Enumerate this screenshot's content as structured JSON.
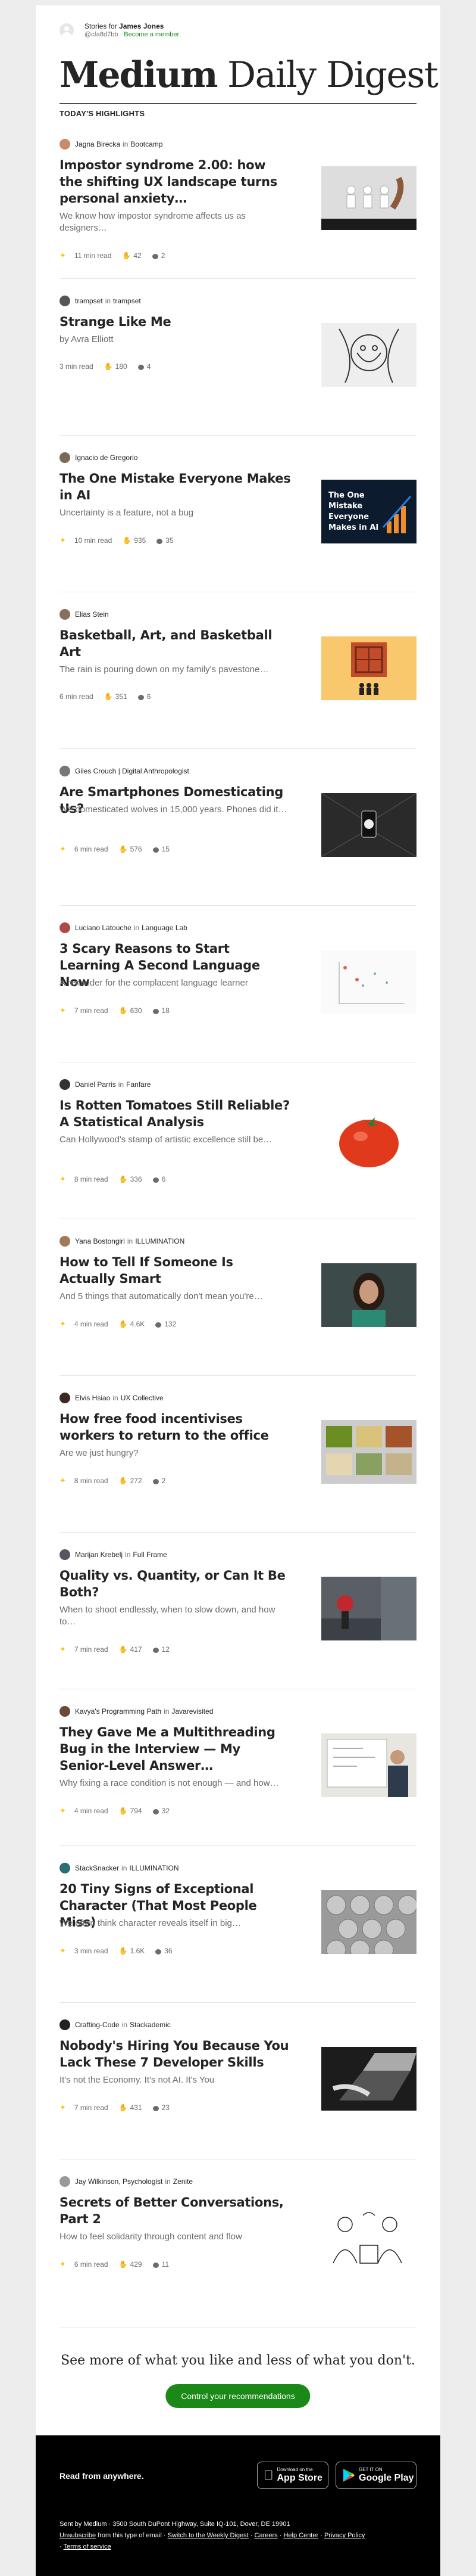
{
  "header": {
    "stories_for_prefix": "Stories for",
    "user_name": "James Jones",
    "handle": "@cfa8d7bb",
    "separator": "·",
    "become_member": "Become a member",
    "masthead_bold": "Medium",
    "masthead_rest": "Daily Digest",
    "section_title": "TODAY'S HIGHLIGHTS"
  },
  "articles": [
    {
      "author": "Jagna Birecka",
      "in": "in",
      "publication": "Bootcamp",
      "title": "Impostor syndrome 2.00: how the shifting UX landscape turns personal anxiety…",
      "subtitle": "We know how impostor syndrome affects us as designers…",
      "read": "11 min read",
      "claps": "42",
      "responses": "2",
      "member": true
    },
    {
      "author": "trampset",
      "in": "in",
      "publication": "trampset",
      "title": "Strange Like Me",
      "subtitle": "by Avra Elliott",
      "read": "3 min read",
      "claps": "180",
      "responses": "4",
      "member": false
    },
    {
      "author": "Ignacio de Gregorio",
      "in": "",
      "publication": "",
      "title": "The One Mistake Everyone Makes in AI",
      "subtitle": "Uncertainty is a feature, not a bug",
      "read": "10 min read",
      "claps": "935",
      "responses": "35",
      "member": true,
      "thumb_text": "The One Mistake Everyone Makes in AI"
    },
    {
      "author": "Elias Stein",
      "in": "",
      "publication": "",
      "title": "Basketball, Art, and Basketball Art",
      "subtitle": "The rain is pouring down on my family's pavestone…",
      "read": "6 min read",
      "claps": "351",
      "responses": "6",
      "member": false
    },
    {
      "author": "Giles Crouch | Digital Anthropologist",
      "in": "",
      "publication": "",
      "title": "Are Smartphones Domesticating Us?",
      "subtitle": "We domesticated wolves in 15,000 years. Phones did it…",
      "read": "6 min read",
      "claps": "576",
      "responses": "15",
      "member": true
    },
    {
      "author": "Luciano Latouche",
      "in": "in",
      "publication": "Language Lab",
      "title": "3 Scary Reasons to Start Learning A Second Language Now",
      "subtitle": "A reminder for the complacent language learner",
      "read": "7 min read",
      "claps": "630",
      "responses": "18",
      "member": true
    },
    {
      "author": "Daniel Parris",
      "in": "in",
      "publication": "Fanfare",
      "title": "Is Rotten Tomatoes Still Reliable? A Statistical Analysis",
      "subtitle": "Can Hollywood's stamp of artistic excellence still be…",
      "read": "8 min read",
      "claps": "336",
      "responses": "6",
      "member": true
    },
    {
      "author": "Yana Bostongirl",
      "in": "in",
      "publication": "ILLUMINATION",
      "title": "How to Tell If Someone Is Actually Smart",
      "subtitle": "And 5 things that automatically don't mean you're…",
      "read": "4 min read",
      "claps": "4.6K",
      "responses": "132",
      "member": true
    },
    {
      "author": "Elvis Hsiao",
      "in": "in",
      "publication": "UX Collective",
      "title": "How free food incentivises workers to return to the office",
      "subtitle": "Are we just hungry?",
      "read": "8 min read",
      "claps": "272",
      "responses": "2",
      "member": true
    },
    {
      "author": "Marijan Krebelj",
      "in": "in",
      "publication": "Full Frame",
      "title": "Quality vs. Quantity, or Can It Be Both?",
      "subtitle": "When to shoot endlessly, when to slow down, and how to…",
      "read": "7 min read",
      "claps": "417",
      "responses": "12",
      "member": true
    },
    {
      "author": "Kavya's Programming Path",
      "in": "in",
      "publication": "Javarevisited",
      "title": "They Gave Me a Multithreading Bug in the Interview — My Senior-Level Answer…",
      "subtitle": "Why fixing a race condition is not enough — and how…",
      "read": "4 min read",
      "claps": "794",
      "responses": "32",
      "member": true
    },
    {
      "author": "StackSnacker",
      "in": "in",
      "publication": "ILLUMINATION",
      "title": "20 Tiny Signs of Exceptional Character (That Most People Miss)",
      "subtitle": "We often think character reveals itself in big…",
      "read": "3 min read",
      "claps": "1.6K",
      "responses": "36",
      "member": true
    },
    {
      "author": "Crafting-Code",
      "in": "in",
      "publication": "Stackademic",
      "title": "Nobody's Hiring You Because You Lack These 7 Developer Skills",
      "subtitle": "It's not the Economy. It's not AI. It's You",
      "read": "7 min read",
      "claps": "431",
      "responses": "23",
      "member": true
    },
    {
      "author": "Jay Wilkinson, Psychologist",
      "in": "in",
      "publication": "Zenite",
      "title": "Secrets of Better Conversations, Part 2",
      "subtitle": "How to feel solidarity through content and flow",
      "read": "6 min read",
      "claps": "429",
      "responses": "11",
      "member": true
    }
  ],
  "cta": {
    "text": "See more of what you like and less of what you don't.",
    "button": "Control your recommendations"
  },
  "footer": {
    "read_from": "Read from anywhere.",
    "app_store_small": "Download on the",
    "app_store_big": "App Store",
    "google_small": "GET IT ON",
    "google_big": "Google Play",
    "address": "Sent by Medium · 3500 South DuPont Highway, Suite IQ-101, Dover, DE 19901",
    "unsubscribe": "Unsubscribe",
    "unsubscribe_rest": "from this type of email",
    "weekly": "Switch to the Weekly Digest",
    "careers": "Careers",
    "help": "Help Center",
    "privacy": "Privacy Policy",
    "terms": "Terms of service",
    "dot": "·"
  },
  "colors": {
    "accent": "#1a8917",
    "member_star": "#ffc017",
    "text": "#242424",
    "muted": "#6b6b6b"
  }
}
